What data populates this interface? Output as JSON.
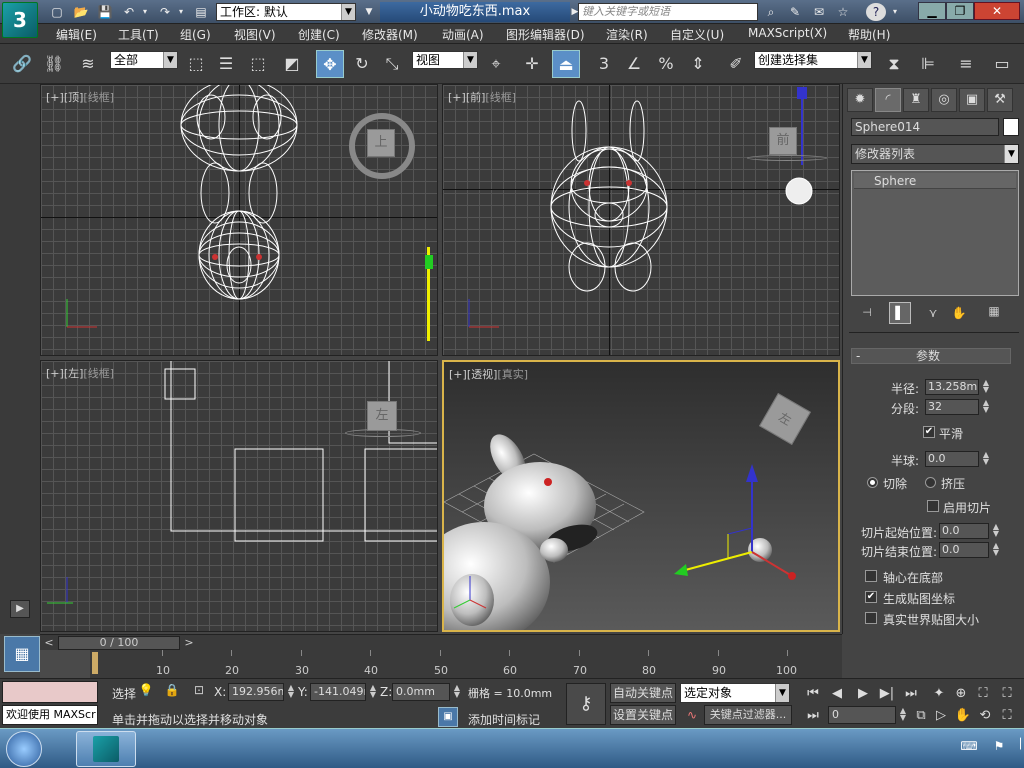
{
  "title": {
    "workspace_label": "工作区: 默认",
    "file_name": "小动物吃东西.max",
    "search_placeholder": "键入关键字或短语",
    "app_icon": "3ds-max-logo-icon"
  },
  "menu": [
    "编辑(E)",
    "工具(T)",
    "组(G)",
    "视图(V)",
    "创建(C)",
    "修改器(M)",
    "动画(A)",
    "图形编辑器(D)",
    "渲染(R)",
    "自定义(U)",
    "MAXScript(X)",
    "帮助(H)"
  ],
  "toolbar": {
    "selection_filter": "全部",
    "ref_coord": "视图",
    "named_selection_placeholder": "创建选择集",
    "snap_label": "3",
    "percent_label": "%"
  },
  "viewports": {
    "top": {
      "plus": "[+]",
      "name": "[顶]",
      "mode": "[线框]",
      "cube_label": "上"
    },
    "front": {
      "plus": "[+]",
      "name": "[前]",
      "mode": "[线框]",
      "cube_label": "前"
    },
    "left": {
      "plus": "[+]",
      "name": "[左]",
      "mode": "[线框]",
      "cube_label": "左"
    },
    "persp": {
      "plus": "[+]",
      "name": "[透视]",
      "mode": "[真实]",
      "cube_label": "左"
    }
  },
  "command_panel": {
    "object_name": "Sphere014",
    "modifier_list": "修改器列表",
    "stack_item": "Sphere",
    "rollout_title": "参数",
    "rollout_toggle": "-",
    "radius_label": "半径:",
    "radius_value": "13.258mm",
    "segments_label": "分段:",
    "segments_value": "32",
    "smooth_label": "平滑",
    "hemisphere_label": "半球:",
    "hemisphere_value": "0.0",
    "chop_label": "切除",
    "squash_label": "挤压",
    "slice_on_label": "启用切片",
    "slice_from_label": "切片起始位置:",
    "slice_from_value": "0.0",
    "slice_to_label": "切片结束位置:",
    "slice_to_value": "0.0",
    "base_to_pivot_label": "轴心在底部",
    "gen_mapping_label": "生成贴图坐标",
    "real_world_label": "真实世界贴图大小",
    "smooth_checked": true,
    "gen_mapping_checked": true
  },
  "timeline": {
    "frame_counter": "0 / 100",
    "ticks": [
      "10",
      "20",
      "30",
      "40",
      "50",
      "60",
      "70",
      "80",
      "90",
      "100"
    ],
    "prev": "<",
    "next": ">"
  },
  "status": {
    "maxscript_listener": "欢迎使用 MAXScr",
    "prompt": "单击并拖动以选择并移动对象",
    "selected_label": "选择",
    "x_label": "X:",
    "x_value": "192.956mm",
    "y_label": "Y:",
    "y_value": "-141.049m",
    "z_label": "Z:",
    "z_value": "0.0mm",
    "grid_label": "栅格 = 10.0mm",
    "add_time_tag": "添加时间标记",
    "auto_key": "自动关键点",
    "set_key": "设置关键点",
    "key_mode": "选定对象",
    "key_filters": "关键点过滤器...",
    "current_frame": "0"
  },
  "colors": {
    "accent_active_viewport": "#d9b44a",
    "selection_blue": "#5b8fc7"
  }
}
